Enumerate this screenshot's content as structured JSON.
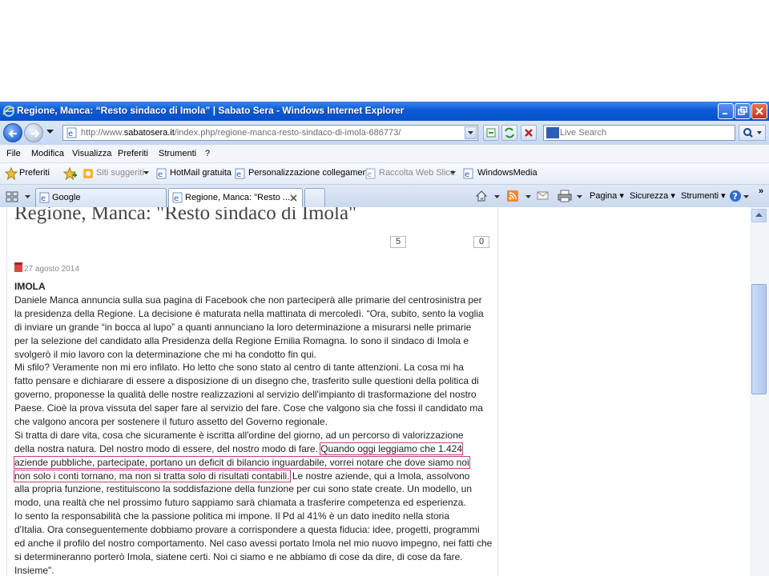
{
  "window": {
    "title": "Regione, Manca: “Resto sindaco di Imola” | Sabato Sera - Windows Internet Explorer"
  },
  "address": {
    "url_prefix": "http://www.",
    "url_domain": "sabatosera.it",
    "url_path": "/index.php/regione-manca-resto-sindaco-di-imola-686773/"
  },
  "search": {
    "placeholder": "Live Search"
  },
  "menu": [
    "File",
    "Modifica",
    "Visualizza",
    "Preferiti",
    "Strumenti",
    "?"
  ],
  "favorites": {
    "label": "Preferiti",
    "items": [
      {
        "label": "Siti suggeriti",
        "enabled": false
      },
      {
        "label": "HotMail gratuita",
        "enabled": true
      },
      {
        "label": "Personalizzazione collegamenti",
        "enabled": true
      },
      {
        "label": "Raccolta Web Slice",
        "enabled": false
      },
      {
        "label": "WindowsMedia",
        "enabled": true
      }
    ]
  },
  "tabs": [
    {
      "label": "Google",
      "active": false
    },
    {
      "label": "Regione, Manca: \"Resto ...",
      "active": true
    }
  ],
  "command_bar": {
    "page": "Pagina",
    "safety": "Sicurezza",
    "tools": "Strumenti"
  },
  "article": {
    "headline": "Regione, Manca: \"Resto sindaco di Imola\"",
    "share_count_1": "5",
    "share_count_2": "0",
    "date": "27 agosto 2014",
    "location": "IMOLA",
    "lines": [
      {
        "pre": "Daniele Manca annuncia sulla sua pagina di Facebook che non parteciperà alle primarie del centrosinistra per"
      },
      {
        "pre": "la presidenza della Regione. La decisione è maturata nella mattinata di mercoledì. “Ora, subito, sento la voglia"
      },
      {
        "pre": "di inviare un grande “in bocca al lupo” a quanti annunciano la loro determinazione a misurarsi nelle primarie"
      },
      {
        "pre": "per la selezione del candidato alla Presidenza della Regione Emilia Romagna. Io sono il sindaco di Imola e"
      },
      {
        "pre": "svolgerò il mio lavoro con la determinazione che mi ha condotto fin qui."
      },
      {
        "pre": "Mi sfilo? Veramente non mi ero infilato. Ho letto che sono stato al centro di tante attenzioni. La cosa mi ha"
      },
      {
        "pre": "fatto pensare e dichiarare di essere a disposizione di un disegno che, trasferito sulle questioni della politica di"
      },
      {
        "pre": "governo, proponesse la qualità delle nostre realizzazioni al servizio dell'impianto di trasformazione del nostro"
      },
      {
        "pre": "Paese. Cioè la prova vissuta del saper fare al servizio del fare. Cose che valgono sia che fossi il candidato ma"
      },
      {
        "pre": "che valgono ancora per sostenere il futuro assetto del Governo regionale."
      },
      {
        "pre": "Si tratta di dare vita, cosa che sicuramente è iscritta all'ordine del giorno, ad un percorso di valorizzazione"
      },
      {
        "pre": "della nostra natura. Del nostro modo di essere, del nostro modo di fare. ",
        "hl": "Quando oggi leggiamo che 1.424"
      },
      {
        "hl": "aziende pubbliche, partecipate, portano un deficit di bilancio inguardabile, vorrei notare che dove siamo noi"
      },
      {
        "hl": "non solo i conti tornano, ma non si tratta solo di risultati contabili.",
        "post": " Le nostre aziende, qui a Imola, assolvono"
      },
      {
        "pre": "alla propria funzione, restituiscono la soddisfazione della funzione per cui sono state create. Un modello, un"
      },
      {
        "pre": "modo, una realtà che nel prossimo futuro sappiamo sarà chiamata a trasferire competenza ed esperienza."
      },
      {
        "pre": "Io sento la responsabilità che la passione politica mi impone. Il Pd al 41% è un dato inedito nella storia"
      },
      {
        "pre": "d'Italia. Ora conseguentemente dobbiamo provare a corrispondere a questa fiducia: idee, progetti, programmi"
      },
      {
        "pre": "ed anche il profilo del nostro comportamento. Nel caso avessi portato Imola nel mio nuovo impegno, nei fatti che"
      },
      {
        "pre": "si determineranno porterò Imola, siatene certi. Noi ci siamo e ne abbiamo di cose da dire, di cose da fare."
      },
      {
        "pre": "Insieme\"."
      }
    ]
  },
  "colors": {
    "titlebar": "#0a5bd9",
    "highlight_box": "#c43d8a"
  }
}
